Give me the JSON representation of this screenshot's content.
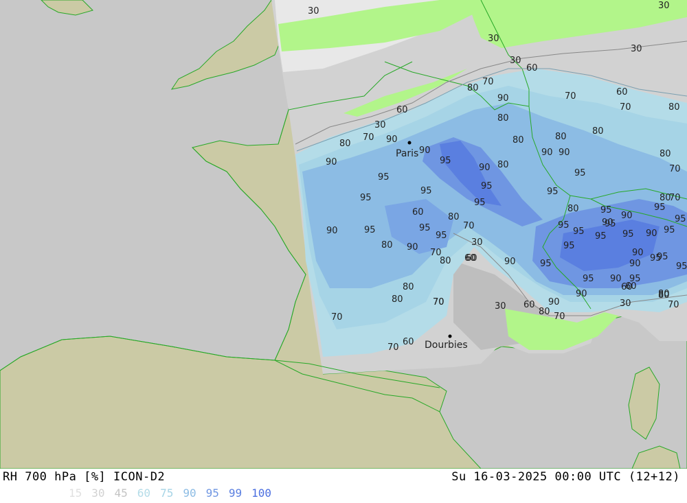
{
  "header": {
    "title": "RH 700 hPa [%] ICON-D2",
    "datetime": "Su 16-03-2025 00:00 UTC (12+12)"
  },
  "legend": [
    {
      "label": "15",
      "color": "#e0e0e0"
    },
    {
      "label": "30",
      "color": "#d2d2d2"
    },
    {
      "label": "45",
      "color": "#c4c4c4"
    },
    {
      "label": "60",
      "color": "#b4dce8"
    },
    {
      "label": "75",
      "color": "#a6d4e6"
    },
    {
      "label": "90",
      "color": "#8cbce4"
    },
    {
      "label": "95",
      "color": "#6f96e2"
    },
    {
      "label": "99",
      "color": "#5a7fe0"
    },
    {
      "label": "100",
      "color": "#4a6ee0"
    }
  ],
  "colors": {
    "land": "#cbcaa5",
    "sea": "#c8c8c8",
    "coastline": "#27a827",
    "dry_green": "#b2f58a"
  },
  "cities": [
    {
      "name": "Paris"
    },
    {
      "name": "Dourbies"
    }
  ],
  "contour_labels": [
    "30",
    "30",
    "30",
    "30",
    "30",
    "60",
    "70",
    "80",
    "90",
    "70",
    "60",
    "80",
    "70",
    "80",
    "80",
    "80",
    "80",
    "60",
    "30",
    "80",
    "70",
    "90",
    "90",
    "95",
    "90",
    "95",
    "80",
    "90",
    "95",
    "95",
    "90",
    "80",
    "70",
    "95",
    "90",
    "95",
    "90",
    "95",
    "95",
    "60",
    "90",
    "80",
    "70",
    "95",
    "80",
    "90",
    "95",
    "95",
    "30",
    "70",
    "60",
    "80",
    "90",
    "95",
    "95",
    "95",
    "95",
    "90",
    "80",
    "70",
    "30",
    "60",
    "80",
    "90",
    "70",
    "80",
    "70",
    "60",
    "60",
    "70",
    "70",
    "95",
    "95",
    "95",
    "95",
    "90",
    "80",
    "80",
    "90",
    "95",
    "95",
    "90",
    "95",
    "95",
    "95",
    "95",
    "95",
    "90",
    "95",
    "60",
    "80",
    "30",
    "70",
    "90",
    "80",
    "60",
    "70"
  ]
}
